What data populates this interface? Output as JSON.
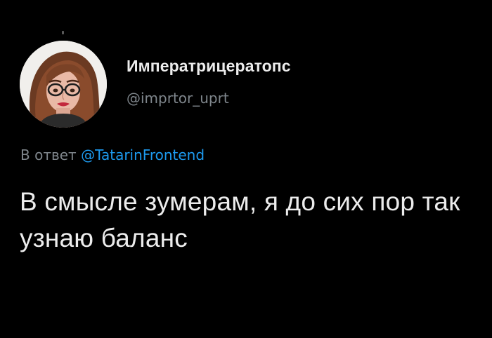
{
  "author": {
    "display_name": "Императрицератопс",
    "handle": "@imprtor_uprt",
    "avatar_icon": "profile-photo-icon"
  },
  "reply": {
    "prefix": "В ответ",
    "to_handle": "@TatarinFrontend"
  },
  "tweet": {
    "text": "В смысле зумерам, я до сих пор так узнаю баланс"
  },
  "colors": {
    "background": "#000000",
    "text": "#ececec",
    "secondary": "#7f868c",
    "link": "#1d9bf0"
  }
}
